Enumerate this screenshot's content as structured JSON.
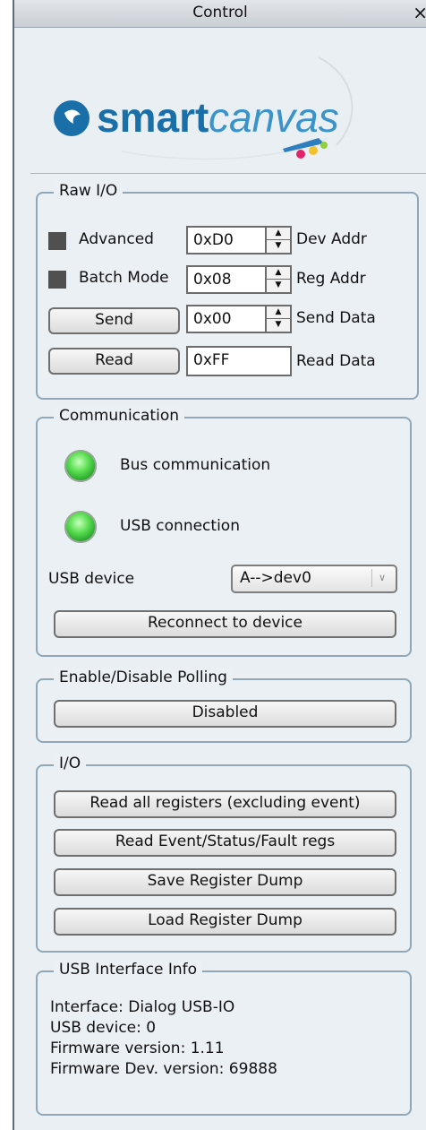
{
  "window": {
    "title": "Control",
    "close_glyph": "×"
  },
  "logo": {
    "text_smart": "smart",
    "text_canvas": "canvas"
  },
  "raw_io": {
    "legend": "Raw I/O",
    "advanced_label": "Advanced",
    "batch_label": "Batch Mode",
    "send_label": "Send",
    "read_label": "Read",
    "dev_addr_value": "0xD0",
    "dev_addr_label": "Dev Addr",
    "reg_addr_value": "0x08",
    "reg_addr_label": "Reg Addr",
    "send_data_value": "0x00",
    "send_data_label": "Send Data",
    "read_data_value": "0xFF",
    "read_data_label": "Read Data"
  },
  "communication": {
    "legend": "Communication",
    "bus_label": "Bus communication",
    "usb_conn_label": "USB connection",
    "usb_device_label": "USB device",
    "usb_device_value": "A-->dev0",
    "reconnect_label": "Reconnect to device",
    "led_color": "#4fd94a"
  },
  "polling": {
    "legend": "Enable/Disable Polling",
    "button_label": "Disabled"
  },
  "io": {
    "legend": "I/O",
    "buttons": [
      "Read all registers (excluding event)",
      "Read Event/Status/Fault regs",
      "Save Register Dump",
      "Load Register Dump"
    ]
  },
  "usb_info": {
    "legend": "USB Interface Info",
    "lines": [
      "Interface: Dialog USB-IO",
      "USB device: 0",
      "Firmware version: 1.11",
      "Firmware Dev. version: 69888"
    ]
  },
  "colors": {
    "panel_bg": "#e9eff3",
    "group_border": "#8fa7b7",
    "brand_blue": "#1a6fa8"
  }
}
